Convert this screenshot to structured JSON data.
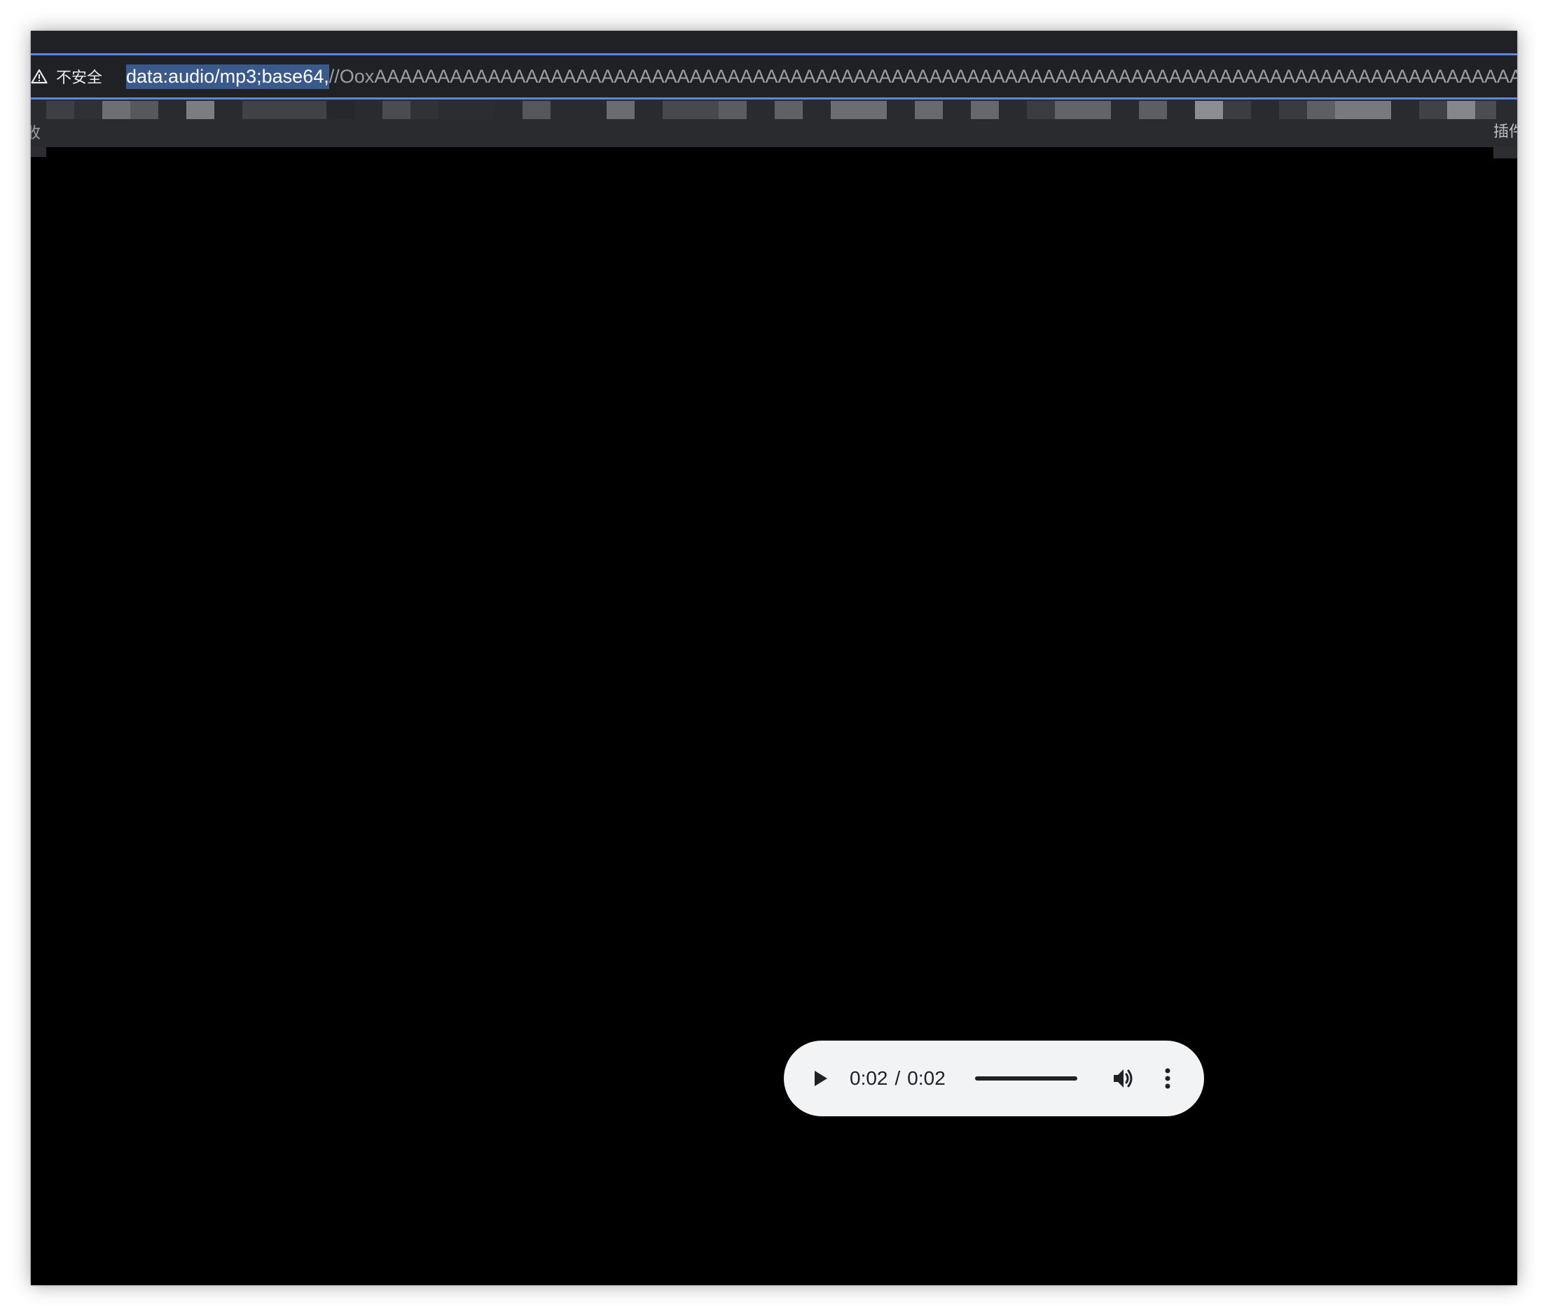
{
  "omnibox": {
    "security_label": "不安全",
    "url_selected": "data:audio/mp3;base64,",
    "url_rest": "//OoxAAAAAAAAAAAAAAAAAAAAAAAAAAAAAAAAAAAAAAAAAAAAAAAAAAAAAAAAAAAAAAAAAAAAAAAAAAAAAAAAAAAAAAAAAAAAAAAAAAAA"
  },
  "bookmarks": {
    "left_fragment": "收",
    "right_fragment": "插件"
  },
  "player": {
    "current_time": "0:02",
    "separator": "/",
    "duration": "0:02",
    "progress": 1.0
  },
  "colors": {
    "selection": "#3b5a8c",
    "focus_ring": "#5b86e5",
    "player_bg": "#f1f3f4",
    "page_bg": "#000000"
  }
}
